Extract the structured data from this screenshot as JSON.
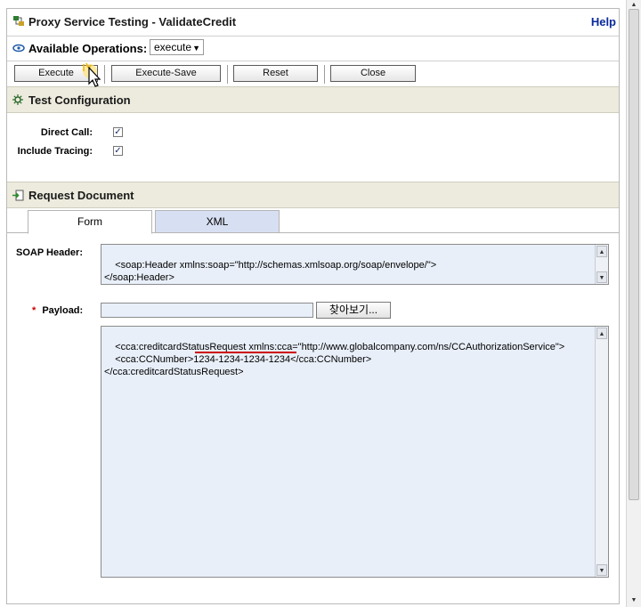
{
  "header": {
    "title": "Proxy Service Testing - ValidateCredit",
    "help": "Help"
  },
  "operations": {
    "label": "Available Operations:",
    "selected": "execute"
  },
  "buttons": {
    "execute": "Execute",
    "execute_save": "Execute-Save",
    "reset": "Reset",
    "close": "Close"
  },
  "test_config": {
    "title": "Test Configuration",
    "direct_call_label": "Direct Call:",
    "include_tracing_label": "Include Tracing:",
    "direct_call_checked": true,
    "include_tracing_checked": true
  },
  "request": {
    "title": "Request Document",
    "tabs": [
      {
        "label": "Form"
      },
      {
        "label": "XML"
      }
    ],
    "soap_header_label": "SOAP Header:",
    "soap_header_value": "<soap:Header xmlns:soap=\"http://schemas.xmlsoap.org/soap/envelope/\">\n</soap:Header>",
    "payload_required_mark": "*",
    "payload_label": "Payload:",
    "browse_label": "찾아보기...",
    "payload_value": "<cca:creditcardStatusRequest xmlns:cca=\"http://www.globalcompany.com/ns/CCAuthorizationService\">\n    <cca:CCNumber>1234-1234-1234-1234</cca:CCNumber>\n</cca:creditcardStatusRequest>"
  },
  "colors": {
    "help_link": "#0a2a9c",
    "section_bg": "#edebdd",
    "field_bg": "#e8eff9",
    "required": "#cc0000",
    "highlight": "#cc0000"
  }
}
